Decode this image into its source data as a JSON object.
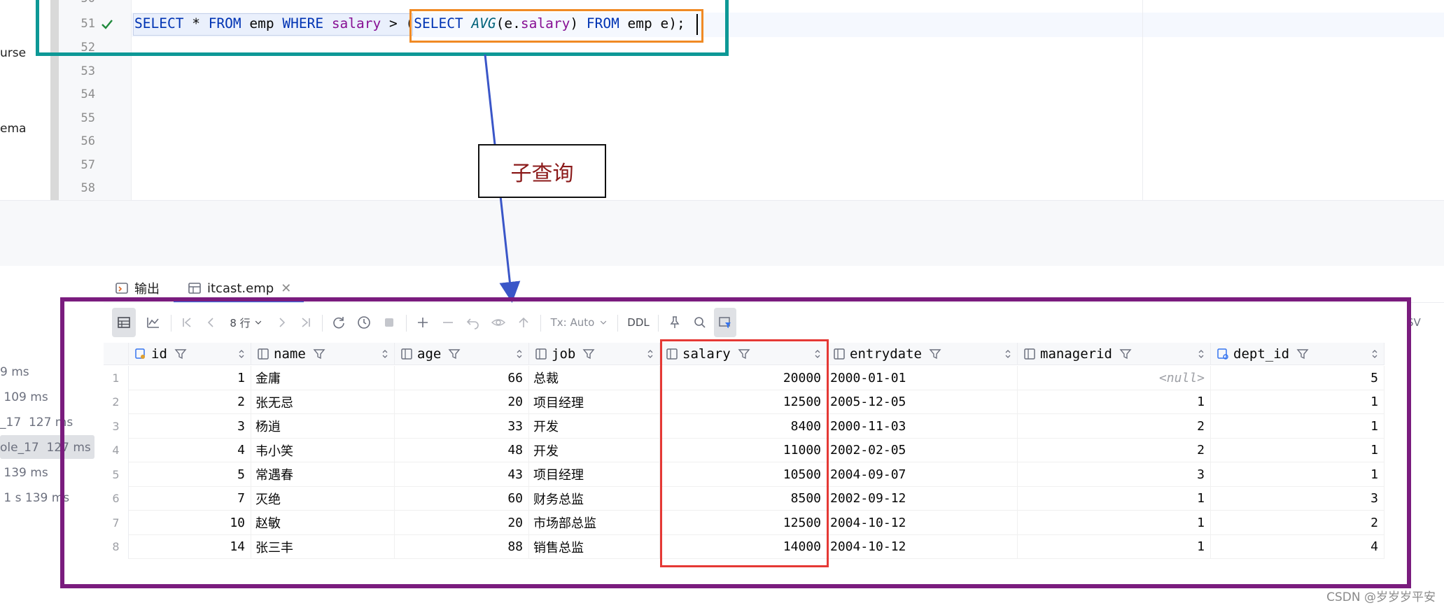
{
  "sidebar": {
    "partial_words": [
      {
        "text": "urse"
      },
      {
        "text": "ema"
      }
    ]
  },
  "editor": {
    "line_numbers": [
      "51",
      "52",
      "53",
      "54",
      "55",
      "56",
      "57",
      "58"
    ],
    "code": {
      "t1": "SELECT",
      "t2": " * ",
      "t3": "FROM",
      "t4": " emp ",
      "t5": "WHERE",
      "t6": " ",
      "t7": "salary",
      "t8": " > (",
      "t9": "SELECT",
      "t10": " ",
      "t11": "AVG",
      "t12": "(e.",
      "t13": "salary",
      "t14": ") ",
      "t15": "FROM",
      "t16": " emp e);"
    }
  },
  "annotation": {
    "label": "子查询",
    "colors": {
      "teal": "#0d9896",
      "orange": "#f08a24",
      "purple": "#7a1c7e",
      "red": "#e53935",
      "arrow": "#3a56c8"
    }
  },
  "panel": {
    "tabs": [
      {
        "label": "输出"
      },
      {
        "label": "itcast.emp"
      }
    ],
    "timings": [
      {
        "text": "9 ms"
      },
      {
        "text": " 109 ms"
      },
      {
        "text": "_17  127 ms"
      },
      {
        "text": "ole_17  127 ms"
      },
      {
        "text": " 139 ms"
      },
      {
        "text": " 1 s 139 ms"
      }
    ],
    "toolbar": {
      "rows_label": "8 行",
      "tx_label": "Tx: Auto",
      "ddl_label": "DDL",
      "csv_label": "SV"
    }
  },
  "table": {
    "columns": [
      "id",
      "name",
      "age",
      "job",
      "salary",
      "entrydate",
      "managerid",
      "dept_id"
    ],
    "rows": [
      {
        "n": "1",
        "id": "1",
        "name": "金庸",
        "age": "66",
        "job": "总裁",
        "salary": "20000",
        "entrydate": "2000-01-01",
        "managerid": "<null>",
        "dept_id": "5"
      },
      {
        "n": "2",
        "id": "2",
        "name": "张无忌",
        "age": "20",
        "job": "项目经理",
        "salary": "12500",
        "entrydate": "2005-12-05",
        "managerid": "1",
        "dept_id": "1"
      },
      {
        "n": "3",
        "id": "3",
        "name": "杨逍",
        "age": "33",
        "job": "开发",
        "salary": "8400",
        "entrydate": "2000-11-03",
        "managerid": "2",
        "dept_id": "1"
      },
      {
        "n": "4",
        "id": "4",
        "name": "韦小笑",
        "age": "48",
        "job": "开发",
        "salary": "11000",
        "entrydate": "2002-02-05",
        "managerid": "2",
        "dept_id": "1"
      },
      {
        "n": "5",
        "id": "5",
        "name": "常遇春",
        "age": "43",
        "job": "项目经理",
        "salary": "10500",
        "entrydate": "2004-09-07",
        "managerid": "3",
        "dept_id": "1"
      },
      {
        "n": "6",
        "id": "7",
        "name": "灭绝",
        "age": "60",
        "job": "财务总监",
        "salary": "8500",
        "entrydate": "2002-09-12",
        "managerid": "1",
        "dept_id": "3"
      },
      {
        "n": "7",
        "id": "10",
        "name": "赵敏",
        "age": "20",
        "job": "市场部总监",
        "salary": "12500",
        "entrydate": "2004-10-12",
        "managerid": "1",
        "dept_id": "2"
      },
      {
        "n": "8",
        "id": "14",
        "name": "张三丰",
        "age": "88",
        "job": "销售总监",
        "salary": "14000",
        "entrydate": "2004-10-12",
        "managerid": "1",
        "dept_id": "4"
      }
    ]
  },
  "watermark": "CSDN @岁岁岁平安"
}
